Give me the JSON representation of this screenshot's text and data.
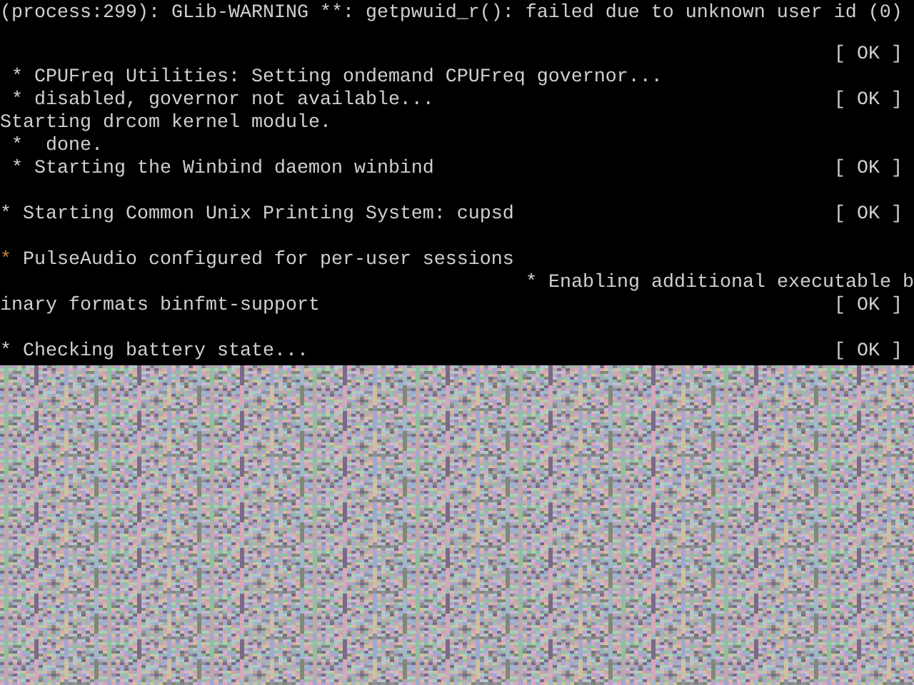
{
  "console_lines": [
    {
      "kind": "line",
      "text": "(process:299): GLib-WARNING **: getpwuid_r(): failed due to unknown user id (0)"
    },
    {
      "kind": "line",
      "status": "[ OK ]"
    },
    {
      "kind": "line",
      "text": " * CPUFreq Utilities: Setting ondemand CPUFreq governor..."
    },
    {
      "kind": "line",
      "text": " * disabled, governor not available...",
      "status": "[ OK ]"
    },
    {
      "kind": "line",
      "text": "Starting drcom kernel module."
    },
    {
      "kind": "line",
      "text": " *  done."
    },
    {
      "kind": "line",
      "text": " * Starting the Winbind daemon winbind",
      "status": "[ OK ]"
    },
    {
      "kind": "spaced",
      "bullet": "*",
      "color": "#cfcfcf",
      "text": " Starting Common Unix Printing System: cupsd",
      "status": "[ OK ]"
    },
    {
      "kind": "spaced",
      "bullet": "*",
      "color": "#c8803a",
      "text": " PulseAudio configured for per-user sessions"
    },
    {
      "kind": "right",
      "text": "* Enabling additional executable b"
    },
    {
      "kind": "line",
      "text": "inary formats binfmt-support",
      "status": "[ OK ]"
    },
    {
      "kind": "spaced",
      "bullet": "*",
      "color": "#cfcfcf",
      "text": " Checking battery state...",
      "status": "[ OK ]"
    }
  ]
}
